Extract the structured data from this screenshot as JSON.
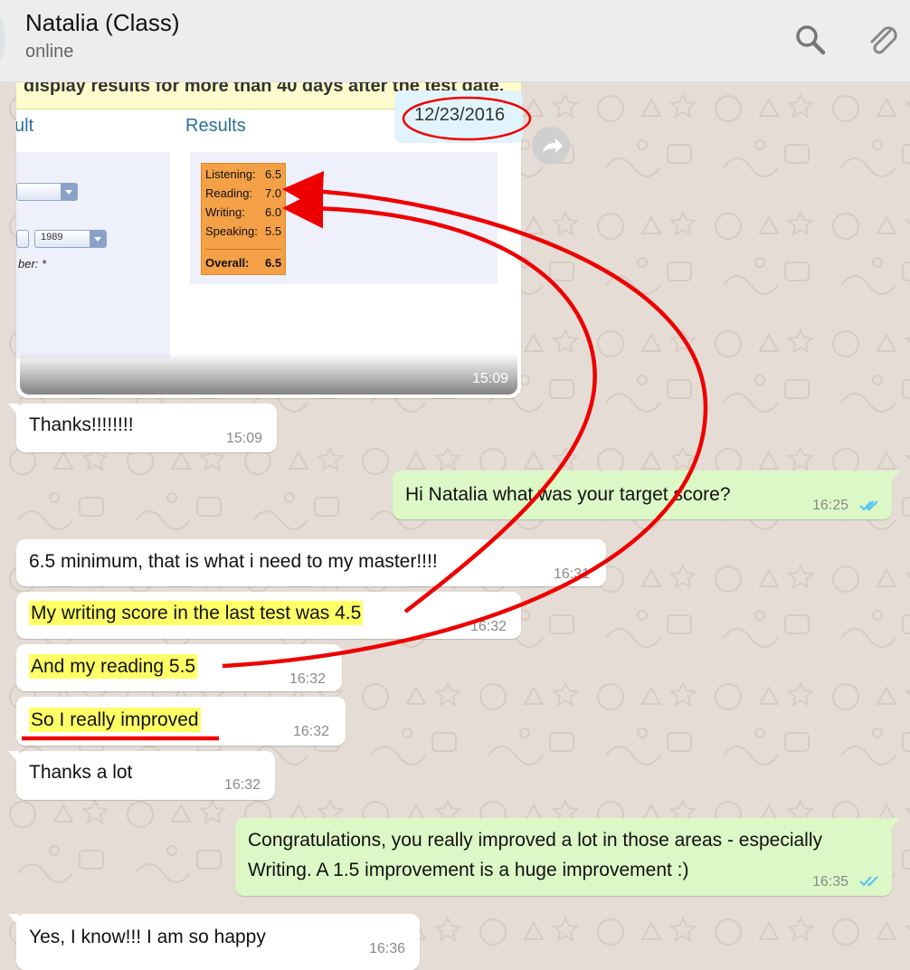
{
  "header": {
    "contact_name": "Natalia (Class)",
    "status": "online"
  },
  "shared_image": {
    "banner_text": "display results for more than 40 days after the test date.",
    "tab_left": "ult",
    "tab_results": "Results",
    "select_year": "1989",
    "field_label": "ber: *",
    "scores": [
      {
        "label": "Listening:",
        "value": "6.5"
      },
      {
        "label": "Reading:",
        "value": "7.0"
      },
      {
        "label": "Writing:",
        "value": "6.0"
      },
      {
        "label": "Speaking:",
        "value": "5.5"
      }
    ],
    "overall_label": "Overall:",
    "overall_value": "6.5",
    "date": "12/23/2016",
    "time": "15:09"
  },
  "messages": [
    {
      "dir": "in",
      "text": "Thanks!!!!!!!!",
      "time": "15:09"
    },
    {
      "dir": "out",
      "text": "Hi Natalia what was your target score?",
      "time": "16:25"
    },
    {
      "dir": "in",
      "text": "6.5 minimum, that is what i need to my master!!!!",
      "time": "16:31"
    },
    {
      "dir": "in",
      "text": "My writing score in the last test was 4.5",
      "time": "16:32"
    },
    {
      "dir": "in",
      "text": "And my reading 5.5",
      "time": "16:32"
    },
    {
      "dir": "in",
      "text": "So I really improved",
      "time": "16:32"
    },
    {
      "dir": "in",
      "text": "Thanks a lot",
      "time": "16:32"
    },
    {
      "dir": "out",
      "text_line1": "Congratulations, you really improved a lot in those areas - especially",
      "text_line2": "Writing. A 1.5 improvement is a huge improvement :)",
      "time": "16:35"
    },
    {
      "dir": "in",
      "text": "Yes, I know!!! I am so happy",
      "time": "16:36"
    }
  ],
  "colors": {
    "header_bg": "#ededed",
    "incoming_bubble": "#ffffff",
    "outgoing_bubble": "#dcf8c6",
    "highlight": "#ffff66",
    "annotation_red": "#ee0000",
    "read_ticks": "#4fc3f7"
  },
  "icons": [
    "search-icon",
    "paperclip-icon",
    "forward-icon",
    "double-check-icon"
  ]
}
